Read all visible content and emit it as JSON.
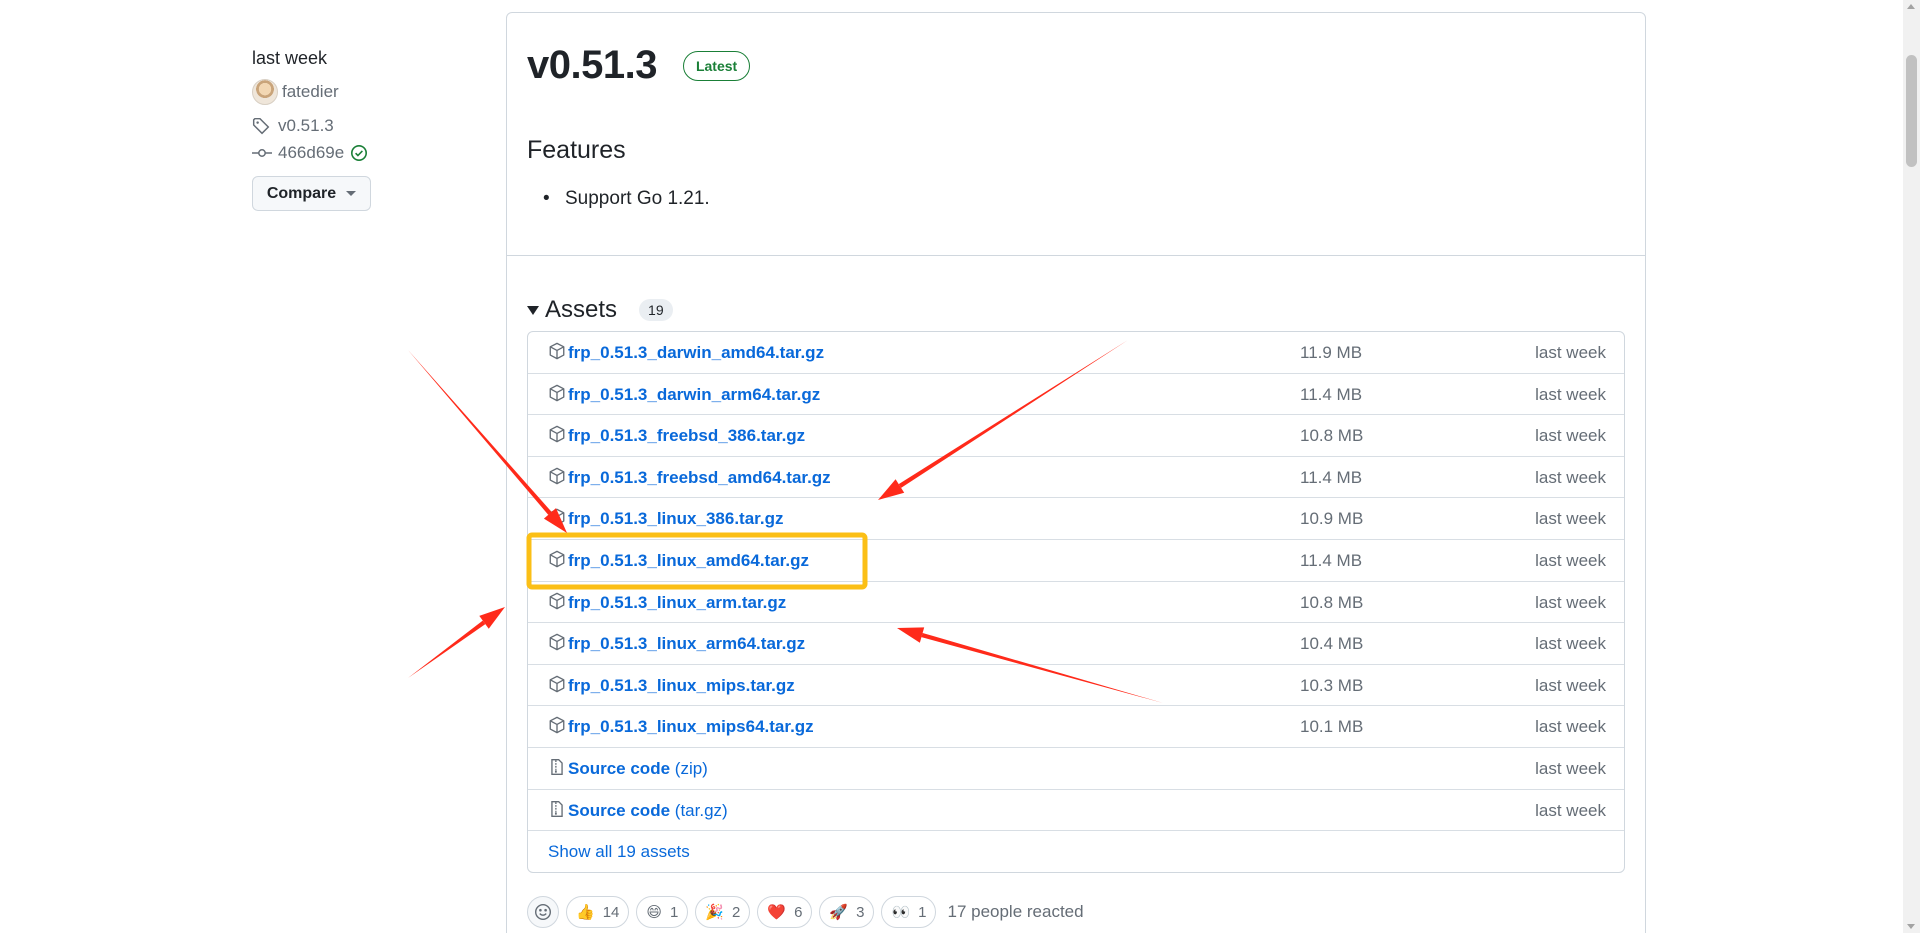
{
  "sidebar": {
    "date": "last week",
    "author": "fatedier",
    "tag": "v0.51.3",
    "commit": "466d69e",
    "compare_label": "Compare"
  },
  "release": {
    "title": "v0.51.3",
    "badge": "Latest",
    "features_heading": "Features",
    "features": [
      "Support Go 1.21."
    ]
  },
  "assets": {
    "heading": "Assets",
    "count": "19",
    "rows": [
      {
        "name": "frp_0.51.3_darwin_amd64.tar.gz",
        "sub": "",
        "size": "11.9 MB",
        "when": "last week",
        "icon": "package-icon"
      },
      {
        "name": "frp_0.51.3_darwin_arm64.tar.gz",
        "sub": "",
        "size": "11.4 MB",
        "when": "last week",
        "icon": "package-icon"
      },
      {
        "name": "frp_0.51.3_freebsd_386.tar.gz",
        "sub": "",
        "size": "10.8 MB",
        "when": "last week",
        "icon": "package-icon"
      },
      {
        "name": "frp_0.51.3_freebsd_amd64.tar.gz",
        "sub": "",
        "size": "11.4 MB",
        "when": "last week",
        "icon": "package-icon"
      },
      {
        "name": "frp_0.51.3_linux_386.tar.gz",
        "sub": "",
        "size": "10.9 MB",
        "when": "last week",
        "icon": "package-icon"
      },
      {
        "name": "frp_0.51.3_linux_amd64.tar.gz",
        "sub": "",
        "size": "11.4 MB",
        "when": "last week",
        "icon": "package-icon"
      },
      {
        "name": "frp_0.51.3_linux_arm.tar.gz",
        "sub": "",
        "size": "10.8 MB",
        "when": "last week",
        "icon": "package-icon"
      },
      {
        "name": "frp_0.51.3_linux_arm64.tar.gz",
        "sub": "",
        "size": "10.4 MB",
        "when": "last week",
        "icon": "package-icon"
      },
      {
        "name": "frp_0.51.3_linux_mips.tar.gz",
        "sub": "",
        "size": "10.3 MB",
        "when": "last week",
        "icon": "package-icon"
      },
      {
        "name": "frp_0.51.3_linux_mips64.tar.gz",
        "sub": "",
        "size": "10.1 MB",
        "when": "last week",
        "icon": "package-icon"
      },
      {
        "name": "Source code",
        "sub": "(zip)",
        "size": "",
        "when": "last week",
        "icon": "file-zip-icon"
      },
      {
        "name": "Source code",
        "sub": "(tar.gz)",
        "size": "",
        "when": "last week",
        "icon": "file-zip-icon"
      }
    ],
    "show_all": "Show all 19 assets"
  },
  "reactions": {
    "items": [
      {
        "emoji": "👍",
        "count": "14",
        "name": "thumbs-up"
      },
      {
        "emoji": "😄",
        "count": "1",
        "name": "laugh"
      },
      {
        "emoji": "🎉",
        "count": "2",
        "name": "hooray"
      },
      {
        "emoji": "❤️",
        "count": "6",
        "name": "heart"
      },
      {
        "emoji": "🚀",
        "count": "3",
        "name": "rocket"
      },
      {
        "emoji": "👀",
        "count": "1",
        "name": "eyes"
      }
    ],
    "summary": "17 people reacted"
  },
  "annotation": {
    "arrow_color": "#ff2a1a",
    "highlight_color": "#fbbf16",
    "highlighted_asset": "frp_0.51.3_linux_amd64.tar.gz"
  }
}
